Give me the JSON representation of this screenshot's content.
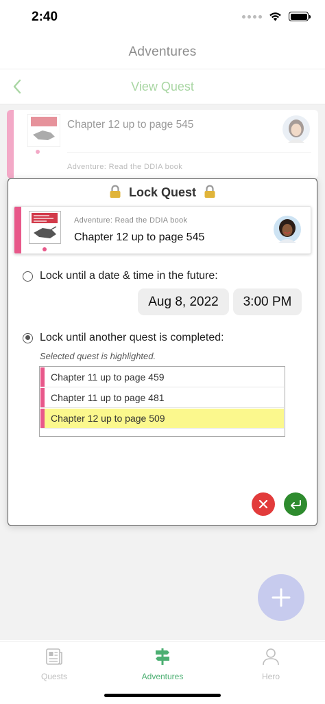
{
  "status_bar": {
    "time": "2:40"
  },
  "header": {
    "title": "Adventures"
  },
  "nav": {
    "title": "View Quest",
    "back_icon": "chevron-left-icon"
  },
  "background_card": {
    "title": "Chapter 12 up to page 545",
    "adventure": "Adventure: Read the DDIA book"
  },
  "modal": {
    "title": "Lock Quest",
    "quest": {
      "adventure": "Adventure: Read the DDIA book",
      "title": "Chapter 12 up to page 545"
    },
    "option_datetime": {
      "label": "Lock until a date & time in the future:",
      "selected": false
    },
    "date": "Aug 8, 2022",
    "time": "3:00 PM",
    "option_quest": {
      "label": "Lock until another quest is completed:",
      "selected": true
    },
    "hint": "Selected quest is highlighted.",
    "quests": [
      {
        "label": "Chapter 11 up to page 459",
        "highlighted": false
      },
      {
        "label": "Chapter 11 up to page 481",
        "highlighted": false
      },
      {
        "label": "Chapter 12 up to page 509",
        "highlighted": true
      }
    ]
  },
  "tabs": [
    {
      "label": "Quests",
      "icon": "newspaper-icon",
      "active": false
    },
    {
      "label": "Adventures",
      "icon": "signpost-icon",
      "active": true
    },
    {
      "label": "Hero",
      "icon": "person-icon",
      "active": false
    }
  ],
  "colors": {
    "accent_green": "#a9d6a3",
    "tab_active": "#4caf72",
    "quest_pink": "#e8588a",
    "highlight_yellow": "#fbf88d",
    "cancel_red": "#e23b3b",
    "confirm_green": "#2e8b2e",
    "fab_lavender": "#c7cbee"
  }
}
